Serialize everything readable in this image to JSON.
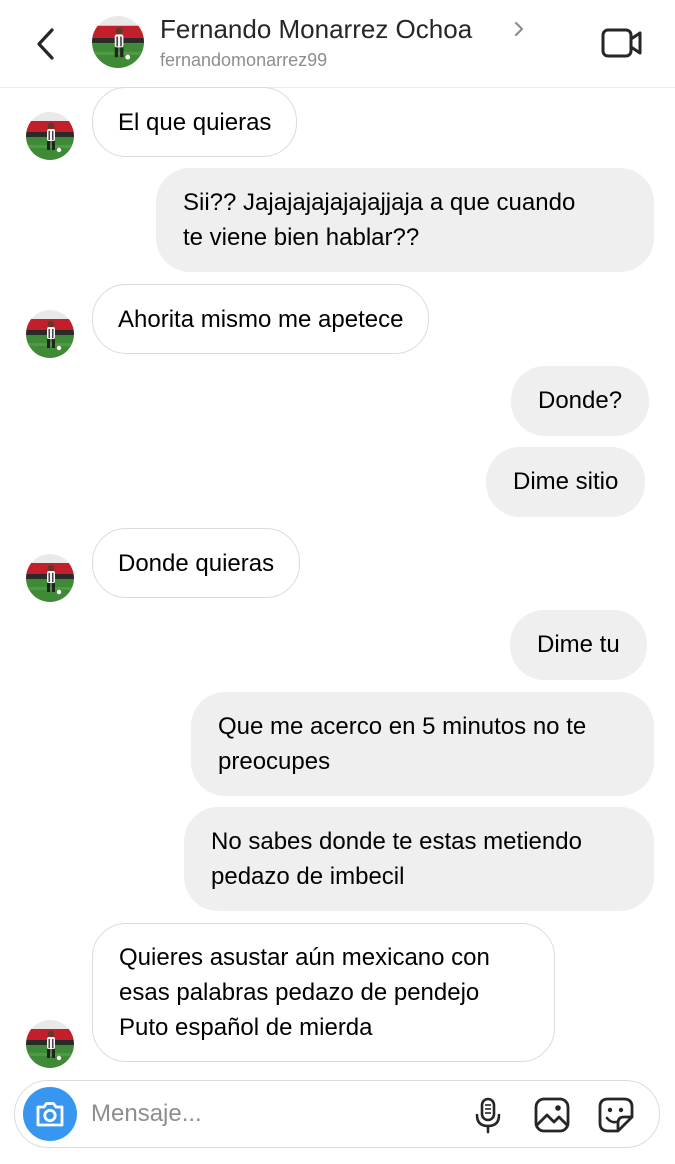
{
  "header": {
    "name": "Fernando Monarrez Ochoa",
    "username": "fernandomonarrez99",
    "back_icon": "chevron-left-icon",
    "video_icon": "video-call-icon"
  },
  "messages": [
    {
      "sender": "contact",
      "text": "El que quieras"
    },
    {
      "sender": "me",
      "lines": [
        "Sii?? Jajajajajajajajjaja a que cuando",
        "te viene bien hablar??"
      ]
    },
    {
      "sender": "contact",
      "text": "Ahorita mismo me apetece"
    },
    {
      "sender": "me",
      "text": "Donde?"
    },
    {
      "sender": "me",
      "text": "Dime sitio"
    },
    {
      "sender": "contact",
      "text": "Donde quieras"
    },
    {
      "sender": "me",
      "text": "Dime tu"
    },
    {
      "sender": "me",
      "lines": [
        "Que me acerco en 5 minutos no te",
        "preocupes"
      ]
    },
    {
      "sender": "me",
      "lines": [
        "No sabes donde te estas metiendo",
        "pedazo de imbecil"
      ]
    },
    {
      "sender": "contact",
      "lines": [
        "Quieres asustar aún mexicano con",
        "esas palabras pedazo de pendejo",
        "Puto español de mierda"
      ]
    }
  ],
  "composer": {
    "placeholder": "Mensaje...",
    "camera_icon": "camera-icon",
    "mic_icon": "microphone-icon",
    "gallery_icon": "image-icon",
    "sticker_icon": "sticker-icon"
  },
  "colors": {
    "accent": "#3797f0",
    "outgoing_bubble": "#efefef",
    "incoming_border": "#dbdbdb",
    "muted_text": "#8e8e8e"
  }
}
